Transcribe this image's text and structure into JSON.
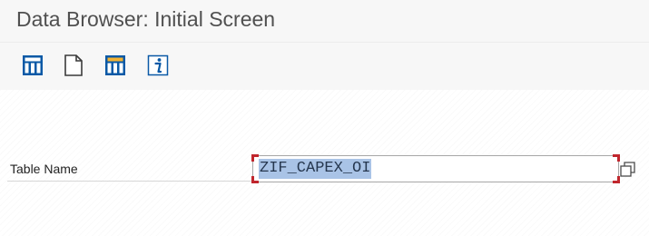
{
  "window": {
    "title": "Data Browser: Initial Screen"
  },
  "toolbar": {
    "buttons": [
      {
        "icon": "table-contents-icon"
      },
      {
        "icon": "new-entries-icon"
      },
      {
        "icon": "number-of-entries-icon"
      },
      {
        "icon": "info-icon"
      }
    ]
  },
  "form": {
    "table_name_label": "Table Name",
    "table_name_value": "ZIF_CAPEX_OI",
    "table_name_selected": true,
    "value_help_icon": "value-help-icon"
  },
  "colors": {
    "icon_blue": "#0a59a6",
    "selection": "#a9c3e6",
    "focus_corner": "#c0262d"
  }
}
